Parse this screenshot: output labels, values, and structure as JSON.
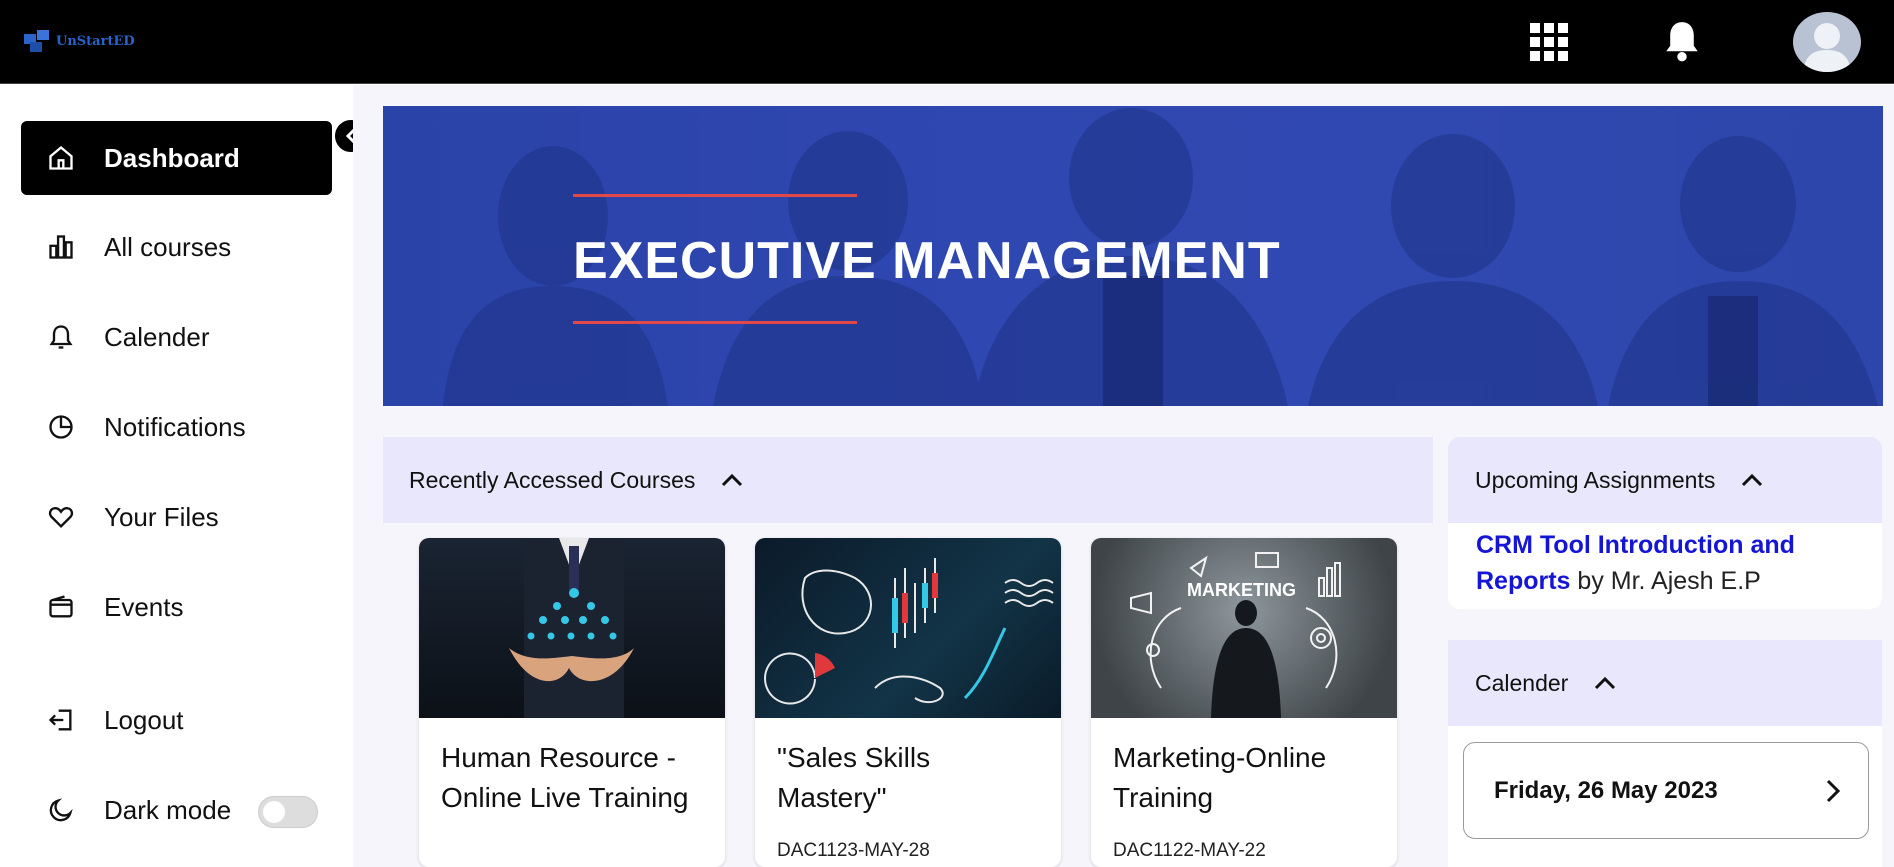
{
  "app": {
    "brand_name": "UnStartED",
    "header_icons": [
      "apps-grid-icon",
      "bell-icon",
      "user-avatar"
    ]
  },
  "sidebar": {
    "items": [
      {
        "label": "Dashboard",
        "icon": "home-icon",
        "active": true
      },
      {
        "label": "All courses",
        "icon": "bar-chart-icon",
        "active": false
      },
      {
        "label": "Calender",
        "icon": "bell-icon",
        "active": false
      },
      {
        "label": "Notifications",
        "icon": "pie-chart-icon",
        "active": false
      },
      {
        "label": "Your Files",
        "icon": "heart-icon",
        "active": false
      },
      {
        "label": "Events",
        "icon": "wallet-icon",
        "active": false
      },
      {
        "label": "Logout",
        "icon": "logout-icon",
        "active": false
      },
      {
        "label": "Dark mode",
        "icon": "moon-icon",
        "active": false,
        "toggle_on": false
      }
    ]
  },
  "banner": {
    "title": "EXECUTIVE MANAGEMENT"
  },
  "recent_courses": {
    "heading": "Recently Accessed Courses",
    "courses": [
      {
        "title": "Human Resource - Online Live Training",
        "code": ""
      },
      {
        "title": "\"Sales Skills Mastery\"",
        "code": "DAC1123-MAY-28"
      },
      {
        "title": "Marketing-Online Training",
        "code": "DAC1122-MAY-22"
      }
    ],
    "image_text": "MARKETING"
  },
  "assignments": {
    "heading": "Upcoming Assignments",
    "item_title": "CRM Tool Introduction and Reports",
    "item_by": " by Mr. Ajesh E.P"
  },
  "calendar": {
    "heading": "Calender",
    "date": "Friday, 26 May 2023"
  },
  "colors": {
    "accent_blue": "#2f47b0",
    "panel_header": "#e8e7fb",
    "link": "#1515d6",
    "banner_rule": "#e34848"
  }
}
